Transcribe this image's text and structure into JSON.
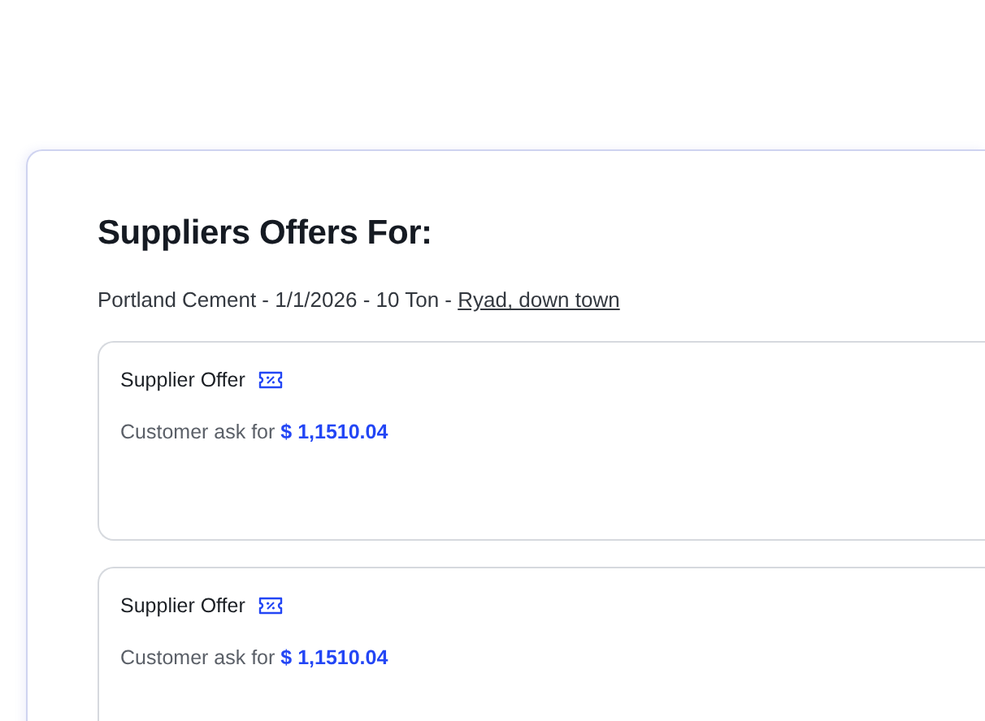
{
  "title": "Suppliers Offers For:",
  "request": {
    "text": "Portland Cement - 1/1/2026 - 10 Ton - ",
    "location": "Ryad, down town"
  },
  "offers": [
    {
      "title": "Supplier Offer",
      "ask": "Customer ask for **$ 1,1510.04**"
    },
    {
      "title": "Supplier Offer",
      "ask": "Customer ask for **$ 1,1510.04**"
    }
  ]
}
